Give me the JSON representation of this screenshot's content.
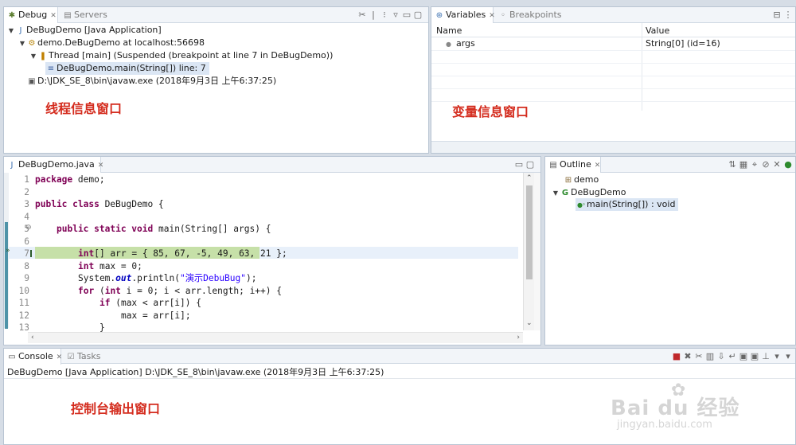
{
  "debug_pane": {
    "tab_label": "Debug",
    "tab2_label": "Servers",
    "tree": [
      {
        "label": "DeBugDemo [Java Application]"
      },
      {
        "label": "demo.DeBugDemo at localhost:56698"
      },
      {
        "label": "Thread [main] (Suspended (breakpoint at line 7 in DeBugDemo))"
      },
      {
        "label": "DeBugDemo.main(String[]) line: 7"
      },
      {
        "label": "D:\\JDK_SE_8\\bin\\javaw.exe (2018年9月3日 上午6:37:25)"
      }
    ],
    "annotation": "线程信息窗口"
  },
  "variables_pane": {
    "tab_label": "Variables",
    "tab2_label": "Breakpoints",
    "col_name": "Name",
    "col_value": "Value",
    "rows": [
      {
        "name": "args",
        "value": "String[0]  (id=16)"
      }
    ],
    "annotation": "变量信息窗口"
  },
  "editor": {
    "tab_label": "DeBugDemo.java",
    "current_line": 7,
    "lines": [
      {
        "n": "1"
      },
      {
        "n": "2"
      },
      {
        "n": "3"
      },
      {
        "n": "4"
      },
      {
        "n": "5"
      },
      {
        "n": "6"
      },
      {
        "n": "7"
      },
      {
        "n": "8"
      },
      {
        "n": "9"
      },
      {
        "n": "10"
      },
      {
        "n": "11"
      },
      {
        "n": "12"
      },
      {
        "n": "13"
      }
    ],
    "code": {
      "l1_kw": "package",
      "l1_rest": " demo;",
      "l3_kw": "public class",
      "l3_rest": " DeBugDemo {",
      "l5_kw": "public static void",
      "l5_rest": " main(String[] args) {",
      "l7_kw": "int",
      "l7_rest": "[] arr = { 85, 67, -5, 49, 63, 21 };",
      "l8_kw": "int",
      "l8_rest": " max = 0;",
      "l9_pre": "System.",
      "l9_fld": "out",
      "l9_mid": ".println(",
      "l9_str": "\"演示DebuBug\"",
      "l9_end": ");",
      "l10_kw": "for",
      "l10_mid": " (",
      "l10_kw2": "int",
      "l10_rest": " i = 0; i < arr.length; i++) {",
      "l11_kw": "if",
      "l11_rest": " (max < arr[i]) {",
      "l12_rest": "max = arr[i];",
      "l13_rest": "}"
    }
  },
  "outline": {
    "tab_label": "Outline",
    "items": [
      {
        "label": "demo"
      },
      {
        "label": "DeBugDemo"
      },
      {
        "label": "main(String[]) : void"
      }
    ]
  },
  "console": {
    "tab_label": "Console",
    "tab2_label": "Tasks",
    "header_line": "DeBugDemo [Java Application] D:\\JDK_SE_8\\bin\\javaw.exe (2018年9月3日 上午6:37:25)",
    "annotation": "控制台输出窗口"
  },
  "watermark": {
    "brand": "Bai du 经验",
    "url": "jingyan.baidu.com"
  },
  "colors": {
    "annotation_red": "#d42c1e",
    "keyword": "#7f0055",
    "string": "#2a00ff",
    "current_line_green": "#c6e0a8"
  }
}
